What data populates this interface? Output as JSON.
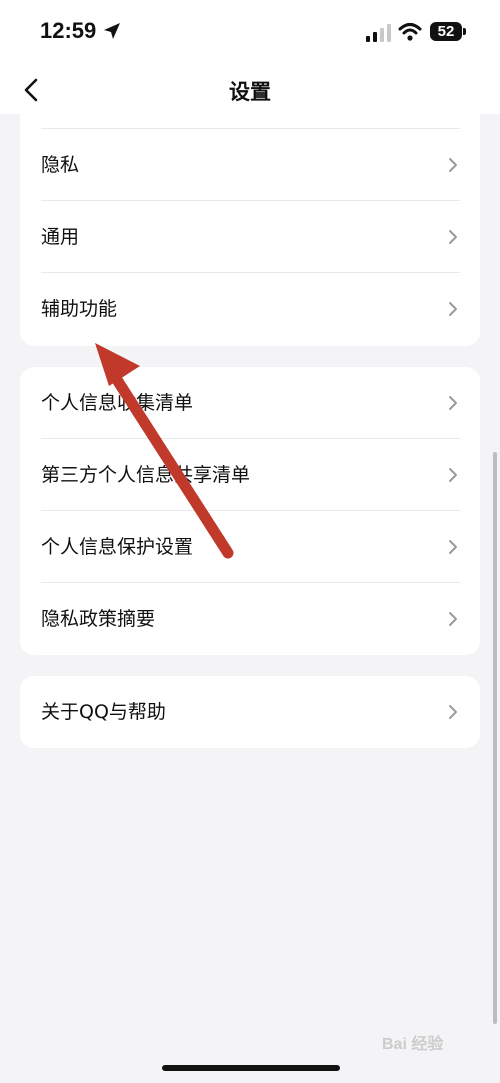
{
  "status_bar": {
    "time": "12:59",
    "battery": "52"
  },
  "nav": {
    "title": "设置"
  },
  "group1": {
    "items": [
      {
        "label": "隐私"
      },
      {
        "label": "通用"
      },
      {
        "label": "辅助功能"
      }
    ]
  },
  "group2": {
    "items": [
      {
        "label": "个人信息收集清单"
      },
      {
        "label": "第三方个人信息共享清单"
      },
      {
        "label": "个人信息保护设置"
      },
      {
        "label": "隐私政策摘要"
      }
    ]
  },
  "group3": {
    "items": [
      {
        "label": "关于QQ与帮助"
      }
    ]
  },
  "watermark": "Bai 经验",
  "colors": {
    "background": "#f4f4f6",
    "card": "#ffffff",
    "arrow": "#c0392b",
    "chevron": "#9b9b9b"
  }
}
